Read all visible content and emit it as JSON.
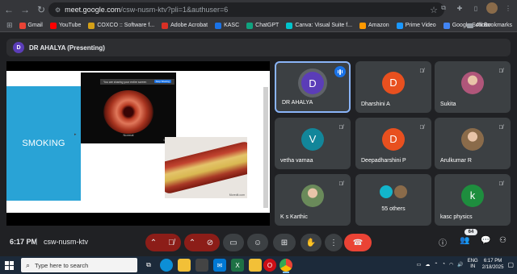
{
  "browser": {
    "url_host": "meet.google.com",
    "url_rest": "/csw-nusm-ktv?pli=1&authuser=6",
    "bookmarks": [
      {
        "label": "Gmail",
        "color": "#ea4335"
      },
      {
        "label": "YouTube",
        "color": "#ff0000"
      },
      {
        "label": "COXCO :: Software f...",
        "color": "#d4a017"
      },
      {
        "label": "Adobe Acrobat",
        "color": "#d93025"
      },
      {
        "label": "KASC",
        "color": "#1a73e8"
      },
      {
        "label": "ChatGPT",
        "color": "#10a37f"
      },
      {
        "label": "Canva: Visual Suite f...",
        "color": "#00c4cc"
      },
      {
        "label": "Amazon",
        "color": "#ff9900"
      },
      {
        "label": "Prime Video",
        "color": "#1a98ff"
      },
      {
        "label": "Google Scholar",
        "color": "#4285f4"
      }
    ],
    "all_bookmarks": "All Bookmarks"
  },
  "presenter": {
    "initial": "D",
    "label": "DR AHALYA (Presenting)"
  },
  "slide": {
    "title": "SMOKING",
    "image1_banner": "You are sharing your entire screen",
    "image1_stop": "Stop Sharing",
    "image1_caption": "Normal",
    "image1_mark": "Moredit",
    "image2_mark": "Moredit.com"
  },
  "participants": [
    {
      "name": "DR AHALYA",
      "initial": "D",
      "color": "#5b3db8",
      "speaking": true
    },
    {
      "name": "Dharshini A",
      "initial": "D",
      "color": "#e8501f",
      "speaking": false
    },
    {
      "name": "Sukita",
      "initial": "",
      "color": "#b0567a",
      "speaking": false
    },
    {
      "name": "vetha varnaa",
      "initial": "V",
      "color": "#12869a",
      "speaking": false
    },
    {
      "name": "Deepadharshini P",
      "initial": "D",
      "color": "#e8501f",
      "speaking": false
    },
    {
      "name": "Arulkumar R",
      "initial": "",
      "color": "#8a6b4a",
      "speaking": false
    },
    {
      "name": "K s Karthic",
      "initial": "",
      "color": "#6a8a5a",
      "speaking": false
    },
    {
      "name": "kasc physics",
      "initial": "k",
      "color": "#1e8e3e",
      "speaking": false
    }
  ],
  "others": {
    "label": "55 others"
  },
  "meeting": {
    "time": "6:17 PM",
    "separator": "|",
    "code": "csw-nusm-ktv",
    "participant_count": "64"
  },
  "taskbar": {
    "search_placeholder": "Type here to search",
    "lang_top": "ENG",
    "lang_bottom": "IN",
    "time": "6:17 PM",
    "date": "2/18/2025"
  },
  "colors": {
    "accent": "#8ab4f8",
    "hangup": "#ea4335",
    "muted": "#8c1d18",
    "slide_band": "#29a3d6"
  }
}
